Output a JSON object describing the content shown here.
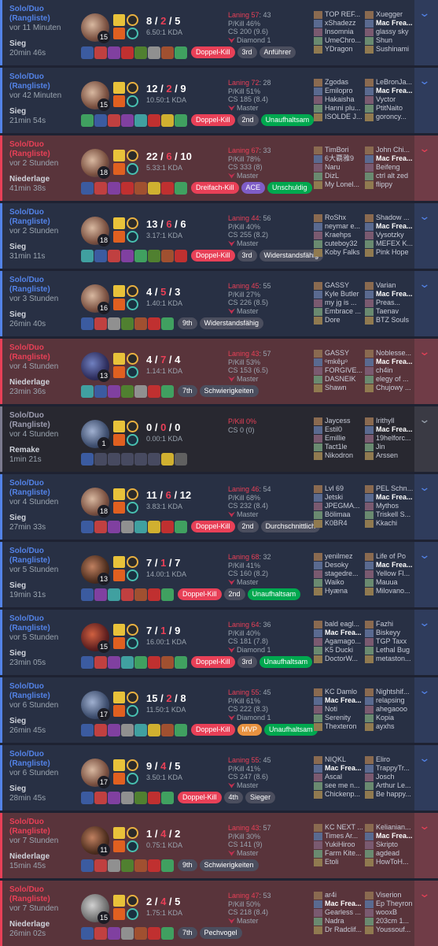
{
  "matches": [
    {
      "queue": "Solo/Duo\n(Rangliste)",
      "time": "vor 11 Minuten",
      "result": "Sieg",
      "duration": "20min 46s",
      "outcome": "win",
      "level": "15",
      "champ": "c1",
      "k": "8",
      "d": "2",
      "a": "5",
      "kda": "6.50:1 KDA",
      "badges": [
        {
          "t": "Doppel-Kill",
          "c": "red"
        },
        {
          "t": "3rd",
          "c": "grey"
        },
        {
          "t": "Anführer",
          "c": "grey"
        }
      ],
      "laning": "Laning 57",
      "laning2": ": 43",
      "pkill": "P/Kill 46%",
      "cs": "CS 200 (9.6)",
      "rank": "Diamond 1",
      "items": [
        "#3b5ba0",
        "#c04040",
        "#8040a0",
        "#c03030",
        "#508030",
        "#909090",
        "#a05030",
        "#40a060"
      ],
      "blue": [
        "TOP REF...",
        "xShadezz",
        "Insomnia",
        "UmeChro...",
        "YDragon"
      ],
      "red": [
        "Xuegger",
        "Mac Frea...",
        "glassy sky",
        "Shun",
        "Sushinami"
      ],
      "me": "red1"
    },
    {
      "queue": "Solo/Duo\n(Rangliste)",
      "time": "vor 42 Minuten",
      "result": "Sieg",
      "duration": "21min 54s",
      "outcome": "win",
      "level": "15",
      "champ": "c1",
      "k": "12",
      "d": "2",
      "a": "9",
      "kda": "10.50:1 KDA",
      "badges": [
        {
          "t": "Doppel-Kill",
          "c": "red"
        },
        {
          "t": "2nd",
          "c": "grey"
        },
        {
          "t": "Unaufhaltsam",
          "c": "green"
        }
      ],
      "laning": "Laning 72",
      "laning2": ": 28",
      "pkill": "P/Kill 51%",
      "cs": "CS 185 (8.4)",
      "rank": "Master",
      "items": [
        "#40a060",
        "#3b5ba0",
        "#c04040",
        "#8040a0",
        "#40a0a0",
        "#c03030",
        "#d0b030",
        "#40a060"
      ],
      "blue": [
        "Zgodas",
        "Emilopro",
        "Hakaisha",
        "Hanni plu...",
        "ISOLDE J..."
      ],
      "red": [
        "LeBronJa...",
        "Mac Frea...",
        "Vyctor",
        "PtitNaito",
        "goroncy..."
      ],
      "me": "red1"
    },
    {
      "queue": "Solo/Duo\n(Rangliste)",
      "time": "vor 2 Stunden",
      "result": "Niederlage",
      "duration": "41min 38s",
      "outcome": "loss",
      "level": "18",
      "champ": "c1",
      "k": "22",
      "d": "6",
      "a": "10",
      "kda": "5.33:1 KDA",
      "badges": [
        {
          "t": "Dreifach-Kill",
          "c": "red"
        },
        {
          "t": "ACE",
          "c": "purple"
        },
        {
          "t": "Unschuldig",
          "c": "green"
        }
      ],
      "laning": "Laning 67",
      "laning2": ": 33",
      "pkill": "P/Kill 78%",
      "cs": "CS 333 (8)",
      "rank": "Master",
      "items": [
        "#3b5ba0",
        "#c04040",
        "#8040a0",
        "#c03030",
        "#a05030",
        "#d0b030",
        "#c03030",
        "#40a060"
      ],
      "blue": [
        "TimBori",
        "6大覇雅9",
        "Naru",
        "DizL",
        "My Lonel..."
      ],
      "red": [
        "John Chi...",
        "Mac Frea...",
        "Beifeng",
        "ctrl alt zed",
        "flippy"
      ],
      "me": "red1"
    },
    {
      "queue": "Solo/Duo\n(Rangliste)",
      "time": "vor 2 Stunden",
      "result": "Sieg",
      "duration": "31min 11s",
      "outcome": "win",
      "level": "18",
      "champ": "c1",
      "k": "13",
      "d": "6",
      "a": "6",
      "kda": "3.17:1 KDA",
      "badges": [
        {
          "t": "Doppel-Kill",
          "c": "red"
        },
        {
          "t": "3rd",
          "c": "grey"
        },
        {
          "t": "Widerstandsfähig",
          "c": "grey"
        }
      ],
      "laning": "Laning 44",
      "laning2": ": 56",
      "pkill": "P/Kill 40%",
      "cs": "CS 255 (8.2)",
      "rank": "Master",
      "items": [
        "#40a0a0",
        "#3b5ba0",
        "#c04040",
        "#8040a0",
        "#40a060",
        "#508030",
        "#a05030",
        "#c03030"
      ],
      "blue": [
        "RoShx",
        "neymar e...",
        "Kraehps",
        "cuteboy32",
        "Koby Falks"
      ],
      "red": [
        "Shadow ...",
        "Mac Frea...",
        "Vysotzky",
        "MEFEX K...",
        "Pink Hope"
      ],
      "me": "red1"
    },
    {
      "queue": "Solo/Duo\n(Rangliste)",
      "time": "vor 3 Stunden",
      "result": "Sieg",
      "duration": "26min 40s",
      "outcome": "win",
      "level": "16",
      "champ": "c1",
      "k": "4",
      "d": "5",
      "a": "3",
      "kda": "1.40:1 KDA",
      "badges": [
        {
          "t": "9th",
          "c": "grey"
        },
        {
          "t": "Widerstandsfähig",
          "c": "grey"
        }
      ],
      "laning": "Laning 45",
      "laning2": ": 55",
      "pkill": "P/Kill 27%",
      "cs": "CS 226 (8.5)",
      "rank": "Master",
      "items": [
        "#3b5ba0",
        "#c04040",
        "#909090",
        "#508030",
        "#a05030",
        "#c03030",
        "#40a060"
      ],
      "blue": [
        "GASSY",
        "Kyle Butler",
        "my jg is ...",
        "Embrace ...",
        "Dore"
      ],
      "red": [
        "Varian",
        "Mac Frea...",
        "Preas...",
        "Taenav",
        "BTZ Souls"
      ],
      "me": "red1"
    },
    {
      "queue": "Solo/Duo\n(Rangliste)",
      "time": "vor 4 Stunden",
      "result": "Niederlage",
      "duration": "23min 36s",
      "outcome": "loss",
      "level": "13",
      "champ": "c2",
      "k": "4",
      "d": "7",
      "a": "4",
      "kda": "1.14:1 KDA",
      "badges": [
        {
          "t": "7th",
          "c": "grey"
        },
        {
          "t": "Schwierigkeiten",
          "c": "grey"
        }
      ],
      "laning": "Laning 43",
      "laning2": ": 57",
      "pkill": "P/Kill 53%",
      "cs": "CS 153 (6.5)",
      "rank": "Master",
      "items": [
        "#40a0a0",
        "#3b5ba0",
        "#8040a0",
        "#508030",
        "#909090",
        "#c03030",
        "#40a060"
      ],
      "blue": [
        "GASSY",
        "ᵒmkêμᵒ",
        "FORGIVE...",
        "DASNEIK",
        "Shawn"
      ],
      "red": [
        "Noblesse...",
        "Mac Frea...",
        "ch4in",
        "elegy of ...",
        "Chujowy ..."
      ],
      "me": "red1"
    },
    {
      "queue": "Solo/Duo\n(Rangliste)",
      "time": "vor 4 Stunden",
      "result": "Remake",
      "duration": "1min 21s",
      "outcome": "remake",
      "level": "1",
      "champ": "c3",
      "k": "0",
      "d": "0",
      "a": "0",
      "kda": "0.00:1 KDA",
      "badges": [],
      "laning": "P/Kill 0%",
      "laning2": "",
      "pkill": "CS 0 (0)",
      "cs": "",
      "rank": "",
      "items": [
        "#3b5ba0",
        "empty",
        "empty",
        "empty",
        "empty",
        "empty",
        "#d0b030",
        "#606060"
      ],
      "blue": [
        "Jaycess",
        "Estil0",
        "Emillie",
        "Tact1le",
        "Nikodron"
      ],
      "red": [
        "Irithyll",
        "Mac Frea...",
        "19helforc...",
        "Jin",
        "Arssen"
      ],
      "me": "red1"
    },
    {
      "queue": "Solo/Duo\n(Rangliste)",
      "time": "vor 4 Stunden",
      "result": "Sieg",
      "duration": "27min 33s",
      "outcome": "win",
      "level": "18",
      "champ": "c1",
      "k": "11",
      "d": "6",
      "a": "12",
      "kda": "3.83:1 KDA",
      "badges": [
        {
          "t": "Doppel-Kill",
          "c": "red"
        },
        {
          "t": "2nd",
          "c": "grey"
        },
        {
          "t": "Durchschnittlich",
          "c": "grey"
        }
      ],
      "laning": "Laning 46",
      "laning2": ": 54",
      "pkill": "P/Kill 68%",
      "cs": "CS 232 (8.4)",
      "rank": "Master",
      "items": [
        "#3b5ba0",
        "#c04040",
        "#8040a0",
        "#909090",
        "#40a0a0",
        "#d0b030",
        "#c03030",
        "#40a060"
      ],
      "blue": [
        "Lvl 69",
        "Jetski",
        "JPEGMA...",
        "Bölimaa",
        "K0BR4"
      ],
      "red": [
        "PEL Schn...",
        "Mac Frea...",
        "Mythos",
        "Triskell S...",
        "Kkachi"
      ],
      "me": "red1"
    },
    {
      "queue": "Solo/Duo\n(Rangliste)",
      "time": "vor 5 Stunden",
      "result": "Sieg",
      "duration": "19min 31s",
      "outcome": "win",
      "level": "13",
      "champ": "c4",
      "k": "7",
      "d": "1",
      "a": "7",
      "kda": "14.00:1 KDA",
      "badges": [
        {
          "t": "Doppel-Kill",
          "c": "red"
        },
        {
          "t": "2nd",
          "c": "grey"
        },
        {
          "t": "Unaufhaltsam",
          "c": "green"
        }
      ],
      "laning": "Laning 68",
      "laning2": ": 32",
      "pkill": "P/Kill 41%",
      "cs": "CS 160 (8.2)",
      "rank": "Master",
      "items": [
        "#3b5ba0",
        "#8040a0",
        "#40a0a0",
        "#c04040",
        "#a05030",
        "#c03030",
        "#40a060"
      ],
      "blue": [
        "yenilmez",
        "Desoky",
        "stagedre...",
        "Waiko",
        "Hyæna"
      ],
      "red": [
        "Life of Po",
        "Mac Frea...",
        "Yellow Fl...",
        "Мauua",
        "Milovano..."
      ],
      "me": "red1"
    },
    {
      "queue": "Solo/Duo\n(Rangliste)",
      "time": "vor 5 Stunden",
      "result": "Sieg",
      "duration": "23min 05s",
      "outcome": "win",
      "level": "15",
      "champ": "c5",
      "k": "7",
      "d": "1",
      "a": "9",
      "kda": "16.00:1 KDA",
      "badges": [
        {
          "t": "Doppel-Kill",
          "c": "red"
        },
        {
          "t": "3rd",
          "c": "grey"
        },
        {
          "t": "Unaufhaltsam",
          "c": "green"
        }
      ],
      "laning": "Laning 64",
      "laning2": ": 36",
      "pkill": "P/Kill 40%",
      "cs": "CS 181 (7.8)",
      "rank": "Diamond 1",
      "items": [
        "#3b5ba0",
        "#c04040",
        "#8040a0",
        "#40a0a0",
        "#40a060",
        "#c03030",
        "#a05030",
        "#40a060"
      ],
      "blue": [
        "bald eagl...",
        "Mac Frea...",
        "Agamago...",
        "K5 Ducki",
        "DoctorW..."
      ],
      "red": [
        "Fazhi",
        "Biskeyy",
        "TGP Taxx",
        "Lethal Bug",
        "metaston..."
      ],
      "me": "blue1"
    },
    {
      "queue": "Solo/Duo\n(Rangliste)",
      "time": "vor 6 Stunden",
      "result": "Sieg",
      "duration": "26min 45s",
      "outcome": "win",
      "level": "17",
      "champ": "c3",
      "k": "15",
      "d": "2",
      "a": "8",
      "kda": "11.50:1 KDA",
      "badges": [
        {
          "t": "Doppel-Kill",
          "c": "red"
        },
        {
          "t": "MVP",
          "c": "orange"
        },
        {
          "t": "Unaufhaltsam",
          "c": "green"
        }
      ],
      "laning": "Laning 55",
      "laning2": ": 45",
      "pkill": "P/Kill 61%",
      "cs": "CS 222 (8.3)",
      "rank": "Diamond 1",
      "items": [
        "#3b5ba0",
        "#c04040",
        "#8040a0",
        "#909090",
        "#40a0a0",
        "#d0b030",
        "#a05030",
        "#40a060"
      ],
      "blue": [
        "KC Damlo",
        "Mac Frea...",
        "Noti",
        "Serenity",
        "Thexteron"
      ],
      "red": [
        "Nightshif...",
        "relapsing",
        "ahegaooo",
        "Kopia",
        "ayxhs"
      ],
      "me": "blue1"
    },
    {
      "queue": "Solo/Duo\n(Rangliste)",
      "time": "vor 6 Stunden",
      "result": "Sieg",
      "duration": "28min 45s",
      "outcome": "win",
      "level": "17",
      "champ": "c1",
      "k": "9",
      "d": "4",
      "a": "5",
      "kda": "3.50:1 KDA",
      "badges": [
        {
          "t": "Doppel-Kill",
          "c": "red"
        },
        {
          "t": "4th",
          "c": "grey"
        },
        {
          "t": "Sieger",
          "c": "grey"
        }
      ],
      "laning": "Laning 55",
      "laning2": ": 45",
      "pkill": "P/Kill 41%",
      "cs": "CS 247 (8.6)",
      "rank": "Master",
      "items": [
        "#3b5ba0",
        "#c04040",
        "#8040a0",
        "#909090",
        "#508030",
        "#c03030",
        "#40a060"
      ],
      "blue": [
        "NIQKL",
        "Mac Frea...",
        "Ascal",
        "see me n...",
        "Chickenp..."
      ],
      "red": [
        "Eliro",
        "TrappyTr...",
        "Josch",
        "Arthur Le...",
        "Be happy..."
      ],
      "me": "blue1"
    },
    {
      "queue": "Solo/Duo\n(Rangliste)",
      "time": "vor 7 Stunden",
      "result": "Niederlage",
      "duration": "15min 45s",
      "outcome": "loss",
      "level": "11",
      "champ": "c4",
      "k": "1",
      "d": "4",
      "a": "2",
      "kda": "0.75:1 KDA",
      "badges": [
        {
          "t": "9th",
          "c": "grey"
        },
        {
          "t": "Schwierigkeiten",
          "c": "grey"
        }
      ],
      "laning": "Laning 43",
      "laning2": ": 57",
      "pkill": "P/Kill 30%",
      "cs": "CS 141 (9)",
      "rank": "Master",
      "items": [
        "#3b5ba0",
        "#c04040",
        "#909090",
        "#508030",
        "#a05030",
        "#c03030",
        "#40a060"
      ],
      "blue": [
        "KC NEXT ...",
        "Times Ar...",
        "YukiHiroo",
        "Farm Kite...",
        "Etoli"
      ],
      "red": [
        "Kelianian...",
        "Mac Frea...",
        "Skripto",
        "agdead",
        "HowToH..."
      ],
      "me": "red1"
    },
    {
      "queue": "Solo/Duo\n(Rangliste)",
      "time": "vor 7 Stunden",
      "result": "Niederlage",
      "duration": "26min 02s",
      "outcome": "loss",
      "level": "15",
      "champ": "c6",
      "k": "2",
      "d": "4",
      "a": "5",
      "kda": "1.75:1 KDA",
      "badges": [
        {
          "t": "7th",
          "c": "grey"
        },
        {
          "t": "Pechvogel",
          "c": "grey"
        }
      ],
      "laning": "Laning 47",
      "laning2": ": 53",
      "pkill": "P/Kill 50%",
      "cs": "CS 218 (8.4)",
      "rank": "Master",
      "items": [
        "#3b5ba0",
        "#c04040",
        "#8040a0",
        "#909090",
        "#a05030",
        "#c03030",
        "#40a060"
      ],
      "blue": [
        "ar4i",
        "Mac Frea...",
        "Gearless ...",
        "Nadra",
        "Dr Radclif..."
      ],
      "red": [
        "Viserion",
        "Ep Theyron",
        "wooxB",
        "203cm 1...",
        "Youssouf..."
      ],
      "me": "blue1"
    }
  ],
  "icons": {
    "expand": "expand-double-chevron-icon",
    "rank": "rank-emblem-icon"
  }
}
